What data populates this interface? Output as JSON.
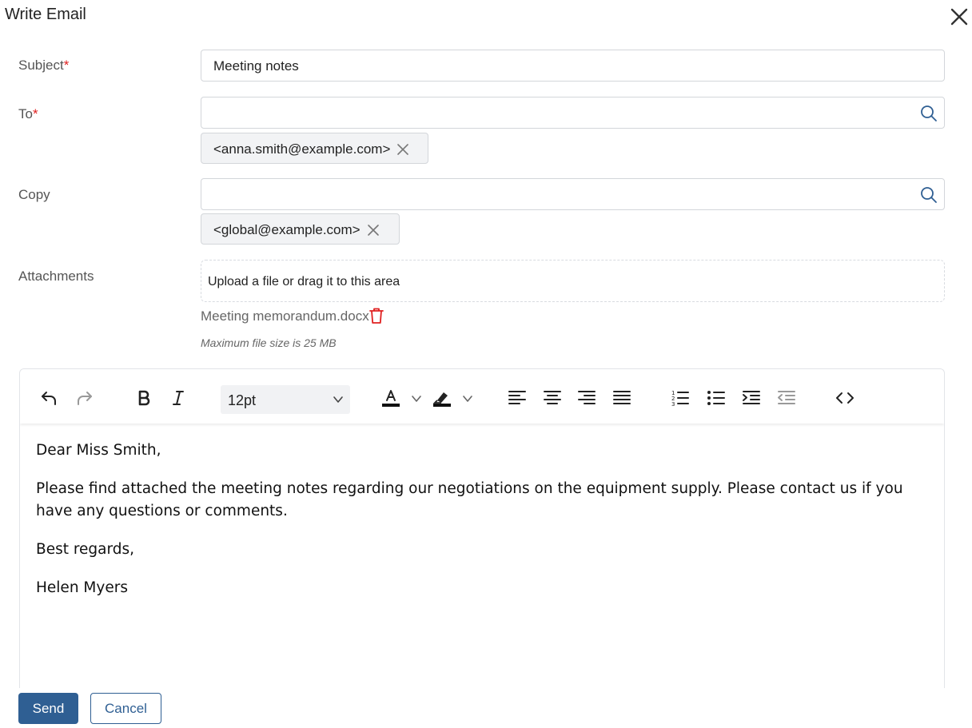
{
  "dialog": {
    "title": "Write Email"
  },
  "colors": {
    "accent": "#2f5f93",
    "required": "#e02020",
    "delete": "#e02020"
  },
  "subject": {
    "label": "Subject",
    "required_mark": "*",
    "value": "Meeting notes"
  },
  "to": {
    "label": "To",
    "required_mark": "*",
    "value": "",
    "chips": [
      "<anna.smith@example.com>"
    ]
  },
  "copy": {
    "label": "Copy",
    "value": "",
    "chips": [
      "<global@example.com>"
    ]
  },
  "attachments": {
    "label": "Attachments",
    "upload_text": "Upload a file or drag it to this area",
    "files": [
      "Meeting memorandum.docx"
    ],
    "max_size_note": "Maximum file size is 25 MB"
  },
  "toolbar": {
    "font_size": "12pt",
    "icons": [
      "undo-icon",
      "redo-icon",
      "bold-icon",
      "italic-icon",
      "text-color-icon",
      "highlight-icon",
      "align-left-icon",
      "align-center-icon",
      "align-right-icon",
      "align-justify-icon",
      "numbered-list-icon",
      "bullet-list-icon",
      "indent-icon",
      "outdent-icon",
      "source-code-icon"
    ]
  },
  "body": {
    "paragraphs": [
      "Dear Miss Smith,",
      "Please find attached the meeting notes regarding our negotiations on the equipment supply. Please contact us if you have any questions or comments.",
      "Best regards,",
      "Helen Myers"
    ]
  },
  "actions": {
    "send": "Send",
    "cancel": "Cancel"
  }
}
